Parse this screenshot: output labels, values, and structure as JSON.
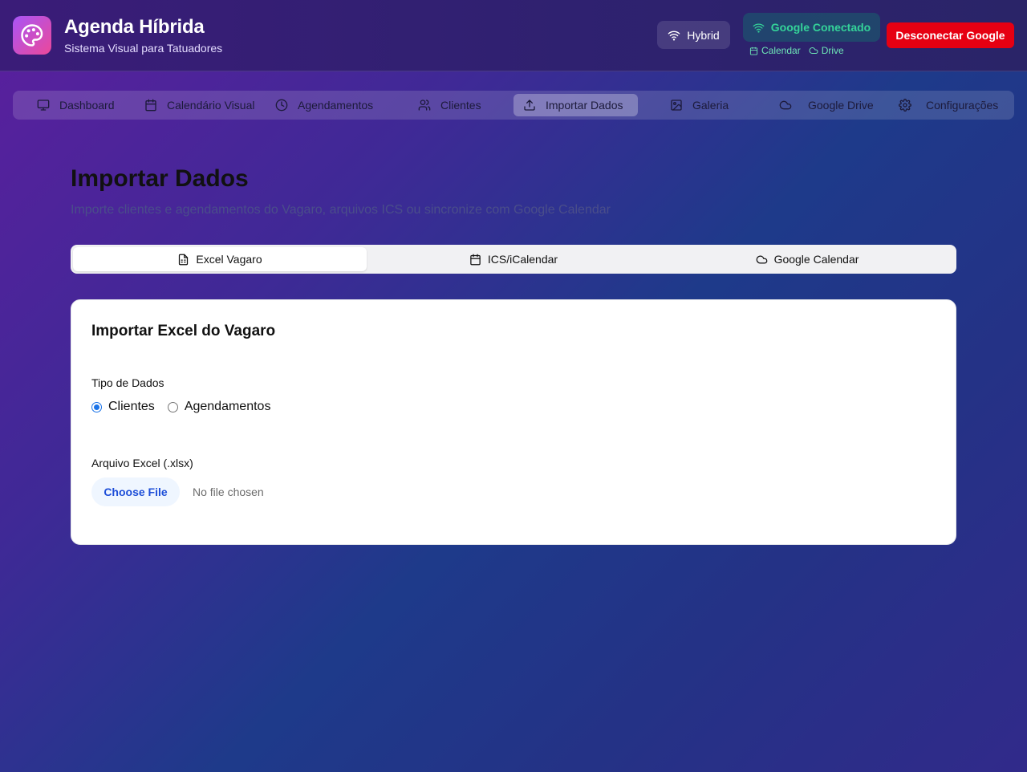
{
  "header": {
    "title": "Agenda Híbrida",
    "subtitle": "Sistema Visual para Tatuadores",
    "logo_icon": "palette-icon",
    "mode_label": "Hybrid",
    "google_status": "Google Conectado",
    "google_services": [
      "Calendar",
      "Drive"
    ],
    "disconnect_label": "Desconectar Google",
    "colors": {
      "accent": "#a855f7",
      "connected": "#34d399",
      "danger": "#e60012"
    }
  },
  "nav": {
    "items": [
      {
        "label": "Dashboard",
        "icon": "monitor-icon"
      },
      {
        "label": "Calendário Visual",
        "icon": "calendar-icon"
      },
      {
        "label": "Agendamentos",
        "icon": "clock-icon"
      },
      {
        "label": "Clientes",
        "icon": "users-icon"
      },
      {
        "label": "Importar Dados",
        "icon": "upload-icon",
        "active": true
      },
      {
        "label": "Galeria",
        "icon": "image-icon"
      },
      {
        "label": "Google Drive",
        "icon": "cloud-icon"
      },
      {
        "label": "Configurações",
        "icon": "gear-icon"
      }
    ]
  },
  "main": {
    "title": "Importar Dados",
    "subtitle": "Importe clientes e agendamentos do Vagaro, arquivos ICS ou sincronize com Google Calendar",
    "tabs": [
      {
        "label": "Excel Vagaro",
        "icon": "file-spreadsheet-icon",
        "active": true
      },
      {
        "label": "ICS/iCalendar",
        "icon": "calendar-icon"
      },
      {
        "label": "Google Calendar",
        "icon": "cloud-icon"
      }
    ],
    "card": {
      "title": "Importar Excel do Vagaro",
      "type_label": "Tipo de Dados",
      "options": [
        {
          "label": "Clientes",
          "checked": true
        },
        {
          "label": "Agendamentos",
          "checked": false
        }
      ],
      "file_label": "Arquivo Excel (.xlsx)",
      "file_button": "Choose File",
      "file_status": "No file chosen"
    }
  }
}
